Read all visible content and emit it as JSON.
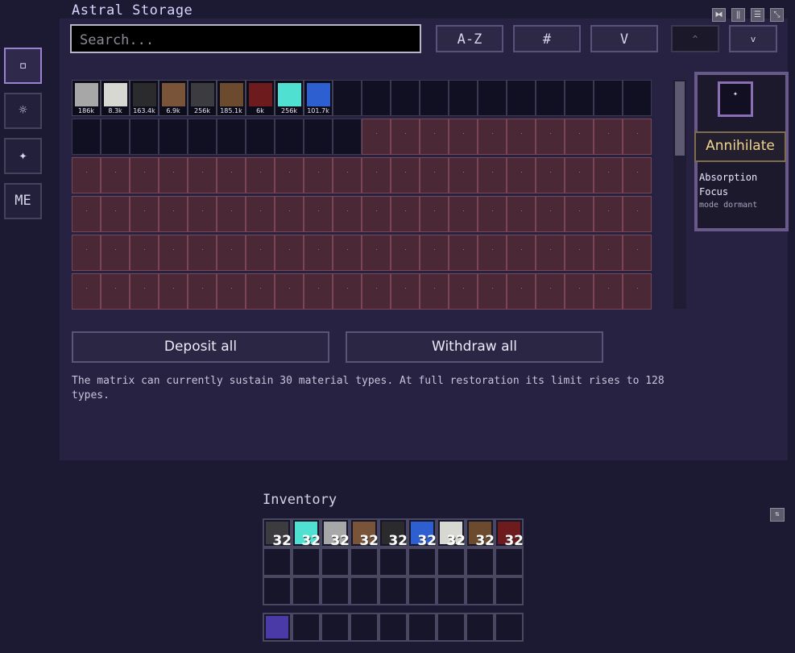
{
  "title": "Astral Storage",
  "search": {
    "placeholder": "Search..."
  },
  "header_buttons": [
    {
      "label": "A-Z"
    },
    {
      "label": "#"
    },
    {
      "label": "V"
    },
    {
      "label": "^"
    },
    {
      "label": "v"
    }
  ],
  "window_icons": [
    "collapse-icon",
    "columns-icon",
    "list-icon",
    "resize-icon"
  ],
  "side_tabs": [
    {
      "label": "▫",
      "icon": "storage-tab-icon",
      "active": true
    },
    {
      "label": "☼",
      "icon": "gear-tab-icon",
      "active": false
    },
    {
      "label": "✦",
      "icon": "star-tab-icon",
      "active": false
    },
    {
      "label": "ME",
      "icon": "me-tab-icon",
      "active": false
    }
  ],
  "storage_items": [
    {
      "item": "granite",
      "count": "186k",
      "color": "#a7a7a7"
    },
    {
      "item": "quartz",
      "count": "8.3k",
      "color": "#d8d8d2"
    },
    {
      "item": "coal",
      "count": "163.4k",
      "color": "#2b2b2e"
    },
    {
      "item": "dirt",
      "count": "6.9k",
      "color": "#7a5438"
    },
    {
      "item": "deepslate",
      "count": "256k",
      "color": "#3b3b40"
    },
    {
      "item": "coarse-dirt",
      "count": "185.1k",
      "color": "#6b4a2e"
    },
    {
      "item": "netherrack",
      "count": "6k",
      "color": "#6d1b1d"
    },
    {
      "item": "diamond",
      "count": "256k",
      "color": "#4fe0d2"
    },
    {
      "item": "lapis",
      "count": "101.7k",
      "color": "#2d5fd0"
    }
  ],
  "storage_grid": {
    "columns": 20,
    "rows": 6,
    "unlocked_slots": 30
  },
  "focus": {
    "slot_glyph": "✦",
    "tooltip": "Annihilate",
    "title": "Absorption\nFocus",
    "status": "mode dormant"
  },
  "actions": {
    "deposit": "Deposit all",
    "withdraw": "Withdraw all"
  },
  "info_text": "The matrix can currently sustain 30 material types. At full restoration its limit rises to 128 types.",
  "inventory": {
    "title": "Inventory",
    "sort_icon": "sort-icon",
    "top_row": [
      {
        "item": "deepslate",
        "count": "32",
        "color": "#3b3b40"
      },
      {
        "item": "diamond",
        "count": "32",
        "color": "#4fe0d2"
      },
      {
        "item": "granite",
        "count": "32",
        "color": "#a7a7a7"
      },
      {
        "item": "dirt",
        "count": "32",
        "color": "#7a5438"
      },
      {
        "item": "coal",
        "count": "32",
        "color": "#2b2b2e"
      },
      {
        "item": "lapis",
        "count": "32",
        "color": "#2d5fd0"
      },
      {
        "item": "quartz",
        "count": "32",
        "color": "#d8d8d2"
      },
      {
        "item": "coarse-dirt",
        "count": "32",
        "color": "#6b4a2e"
      },
      {
        "item": "netherrack",
        "count": "32",
        "color": "#6d1b1d"
      }
    ],
    "hotbar": [
      {
        "item": "astral-matrix",
        "count": "",
        "color": "#4a3aa8"
      }
    ]
  }
}
